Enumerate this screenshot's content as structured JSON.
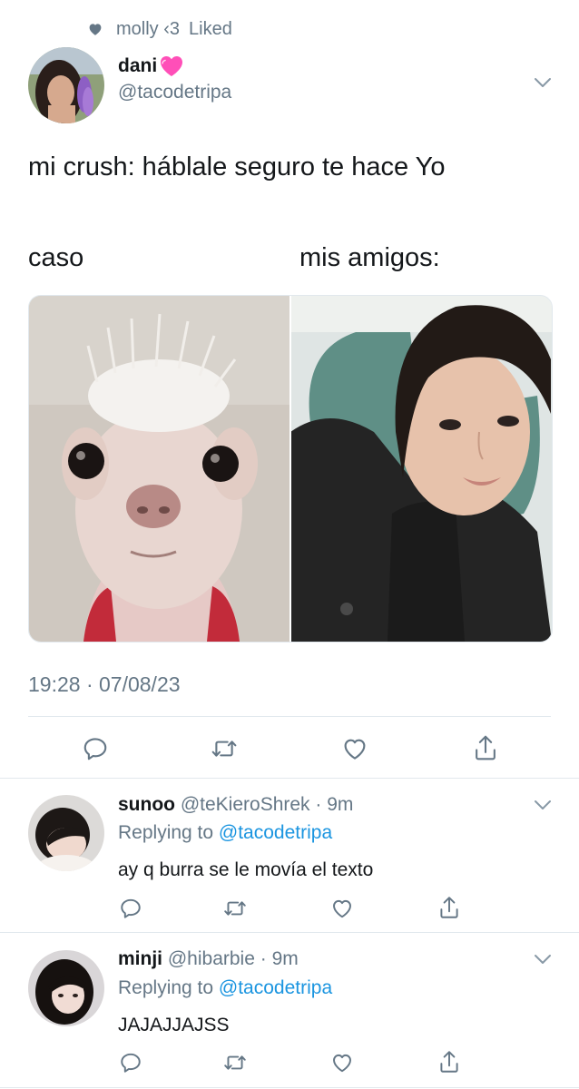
{
  "social_context": {
    "user": "molly ‹3",
    "action": "Liked"
  },
  "tweet": {
    "display_name": "dani",
    "handle": "@tacodetripa",
    "text_line1": "mi crush: háblale seguro te hace Yo",
    "caption_left": "caso",
    "caption_right": "mis amigos:",
    "timestamp": "19:28 · 07/08/23"
  },
  "replies": [
    {
      "name": "sunoo",
      "handle": "@teKieroShrek",
      "time": "· 9m",
      "replying_prefix": "Replying to",
      "replying_handle": "@tacodetripa",
      "text": "ay q burra se le movía el texto"
    },
    {
      "name": "minji",
      "handle": "@hibarbie",
      "time": "· 9m",
      "replying_prefix": "Replying to",
      "replying_handle": "@tacodetripa",
      "text": "JAJAJJAJSS"
    }
  ],
  "colors": {
    "accent": "#1b95e0",
    "muted": "#657786",
    "heart": "#e0245e",
    "divider": "#e1e8ed"
  },
  "icons": [
    "heart-icon",
    "chevron-down-icon",
    "reply-icon",
    "retweet-icon",
    "like-icon",
    "share-icon"
  ]
}
